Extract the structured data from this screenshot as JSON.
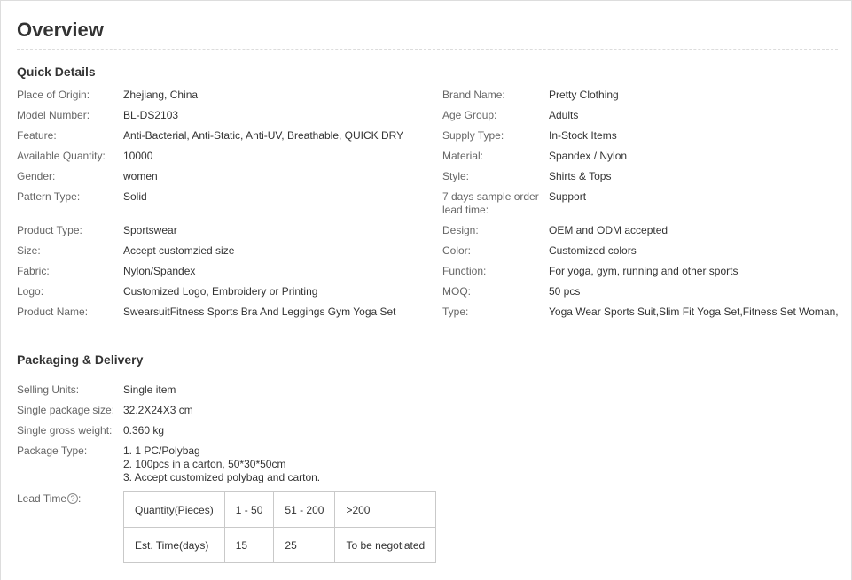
{
  "overview": {
    "title": "Overview"
  },
  "quick_details": {
    "title": "Quick Details",
    "left": [
      {
        "key": "Place of Origin:",
        "value": "Zhejiang, China"
      },
      {
        "key": "Model Number:",
        "value": "BL-DS2103"
      },
      {
        "key": "Feature:",
        "value": "Anti-Bacterial, Anti-Static, Anti-UV, Breathable, QUICK DRY"
      },
      {
        "key": "Available Quantity:",
        "value": "10000"
      },
      {
        "key": "Gender:",
        "value": "women"
      },
      {
        "key": "Pattern Type:",
        "value": "Solid"
      },
      {
        "key": "Product Type:",
        "value": "Sportswear"
      },
      {
        "key": "Size:",
        "value": "Accept customzied size"
      },
      {
        "key": "Fabric:",
        "value": "Nylon/Spandex"
      },
      {
        "key": "Logo:",
        "value": "Customized Logo, Embroidery or Printing"
      },
      {
        "key": "Product Name:",
        "value": "SwearsuitFitness Sports Bra And Leggings Gym Yoga Set"
      }
    ],
    "right": [
      {
        "key": "Brand Name:",
        "value": "Pretty Clothing"
      },
      {
        "key": "Age Group:",
        "value": "Adults"
      },
      {
        "key": "Supply Type:",
        "value": "In-Stock Items"
      },
      {
        "key": "Material:",
        "value": "Spandex / Nylon"
      },
      {
        "key": "Style:",
        "value": "Shirts & Tops"
      },
      {
        "key_line1": "7 days sample order",
        "key_line2": "lead time:",
        "value": "Support"
      },
      {
        "key": "Design:",
        "value": "OEM and ODM accepted"
      },
      {
        "key": "Color:",
        "value": "Customized colors"
      },
      {
        "key": "Function:",
        "value": "For yoga, gym, running and other sports"
      },
      {
        "key": "MOQ:",
        "value": "50 pcs"
      },
      {
        "key": "Type:",
        "value": "Yoga Wear Sports Suit,Slim Fit Yoga Set,Fitness Set Woman,"
      }
    ]
  },
  "packaging": {
    "title": "Packaging & Delivery",
    "items": [
      {
        "key": "Selling Units:",
        "value": "Single item"
      },
      {
        "key": "Single package size:",
        "value": "32.2X24X3 cm"
      },
      {
        "key": "Single gross weight:",
        "value": "0.360 kg"
      }
    ],
    "package_type": {
      "key": "Package Type:",
      "lines": [
        "1. 1 PC/Polybag",
        "2. 100pcs in a carton, 50*30*50cm",
        "3. Accept customized polybag and carton."
      ]
    },
    "lead_time": {
      "key": "Lead Time",
      "help_glyph": "?",
      "colon": ":",
      "rows": [
        [
          "Quantity(Pieces)",
          "1 - 50",
          "51 - 200",
          ">200"
        ],
        [
          "Est. Time(days)",
          "15",
          "25",
          "To be negotiated"
        ]
      ]
    }
  }
}
